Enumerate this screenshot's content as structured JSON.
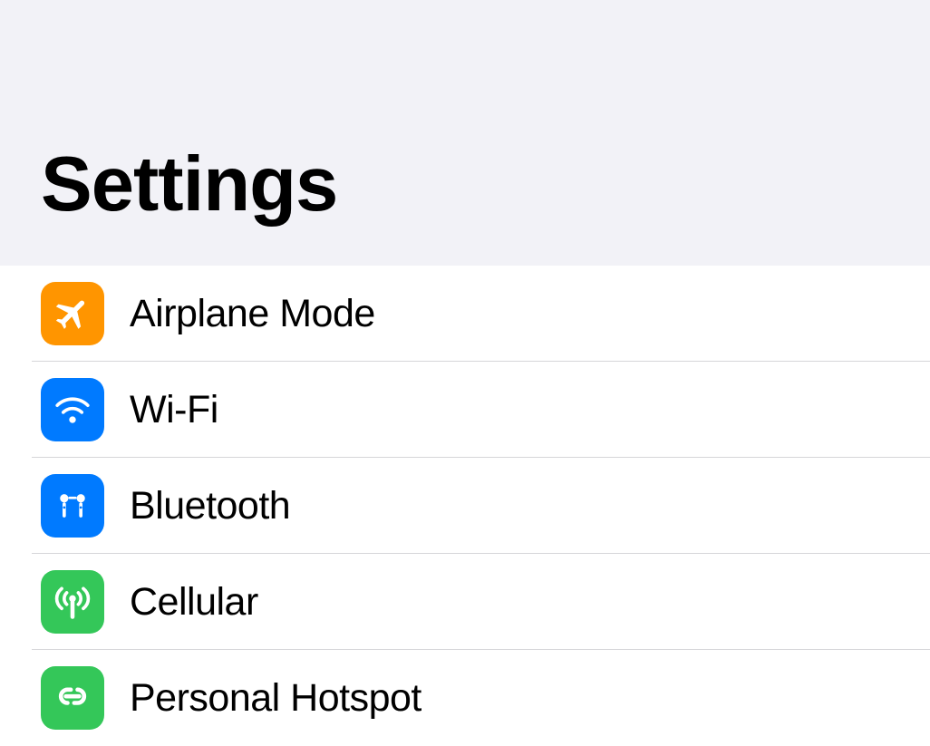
{
  "header": {
    "title": "Settings"
  },
  "rows": [
    {
      "label": "Airplane Mode",
      "icon": "airplane-icon",
      "color": "orange"
    },
    {
      "label": "Wi-Fi",
      "icon": "wifi-icon",
      "color": "blue"
    },
    {
      "label": "Bluetooth",
      "icon": "bluetooth-icon",
      "color": "blue"
    },
    {
      "label": "Cellular",
      "icon": "cellular-icon",
      "color": "green"
    },
    {
      "label": "Personal Hotspot",
      "icon": "hotspot-icon",
      "color": "green"
    }
  ]
}
